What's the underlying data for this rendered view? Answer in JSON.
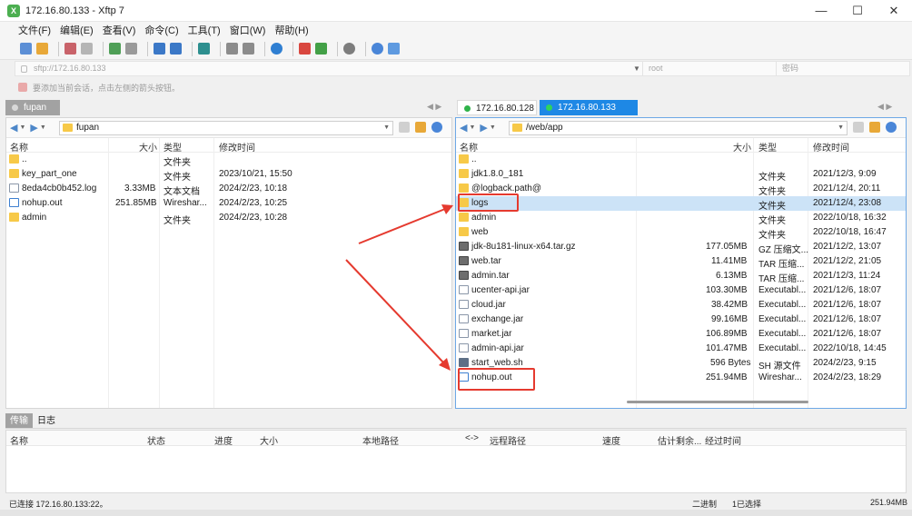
{
  "window": {
    "title": "172.16.80.133 - Xftp 7",
    "app_icon_glyph": "X",
    "minimize": "—",
    "maximize": "☐",
    "close": "✕"
  },
  "menu": [
    "文件(F)",
    "编辑(E)",
    "查看(V)",
    "命令(C)",
    "工具(T)",
    "窗口(W)",
    "帮助(H)"
  ],
  "address": {
    "url_placeholder": "sftp://172.16.80.133",
    "user_placeholder": "root",
    "password_placeholder": "密码"
  },
  "hint": "要添加当前会话，点击左侧的箭头按钮。",
  "tabs": {
    "left": "fupan",
    "right_1": "172.16.80.128",
    "right_2": "172.16.80.133"
  },
  "left_pane": {
    "path": "fupan",
    "columns": {
      "name": "名称",
      "size": "大小",
      "type": "类型",
      "modified": "修改时间"
    },
    "rows": [
      {
        "icon": "folder",
        "name": "..",
        "size": "",
        "type": "文件夹",
        "modified": ""
      },
      {
        "icon": "folder",
        "name": "key_part_one",
        "size": "",
        "type": "文件夹",
        "modified": "2023/10/21, 15:50"
      },
      {
        "icon": "file",
        "name": "8eda4cb0b452.log",
        "size": "3.33MB",
        "type": "文本文档",
        "modified": "2024/2/23, 10:18"
      },
      {
        "icon": "log",
        "name": "nohup.out",
        "size": "251.85MB",
        "type": "Wireshar...",
        "modified": "2024/2/23, 10:25"
      },
      {
        "icon": "folder",
        "name": "admin",
        "size": "",
        "type": "文件夹",
        "modified": "2024/2/23, 10:28"
      }
    ]
  },
  "right_pane": {
    "path": "/web/app",
    "columns": {
      "name": "名称",
      "size": "大小",
      "type": "类型",
      "modified": "修改时间"
    },
    "rows": [
      {
        "icon": "folder",
        "name": "..",
        "size": "",
        "type": "",
        "modified": ""
      },
      {
        "icon": "folder",
        "name": "jdk1.8.0_181",
        "size": "",
        "type": "文件夹",
        "modified": "2021/12/3, 9:09"
      },
      {
        "icon": "folder",
        "name": "@logback.path@",
        "size": "",
        "type": "文件夹",
        "modified": "2021/12/4, 20:11"
      },
      {
        "icon": "folder",
        "name": "logs",
        "size": "",
        "type": "文件夹",
        "modified": "2021/12/4, 23:08"
      },
      {
        "icon": "folder",
        "name": "admin",
        "size": "",
        "type": "文件夹",
        "modified": "2022/10/18, 16:32"
      },
      {
        "icon": "folder",
        "name": "web",
        "size": "",
        "type": "文件夹",
        "modified": "2022/10/18, 16:47"
      },
      {
        "icon": "package",
        "name": "jdk-8u181-linux-x64.tar.gz",
        "size": "177.05MB",
        "type": "GZ 压缩文...",
        "modified": "2021/12/2, 13:07"
      },
      {
        "icon": "package",
        "name": "web.tar",
        "size": "11.41MB",
        "type": "TAR 压缩...",
        "modified": "2021/12/2, 21:05"
      },
      {
        "icon": "package",
        "name": "admin.tar",
        "size": "6.13MB",
        "type": "TAR 压缩...",
        "modified": "2021/12/3, 11:24"
      },
      {
        "icon": "file",
        "name": "ucenter-api.jar",
        "size": "103.30MB",
        "type": "Executabl...",
        "modified": "2021/12/6, 18:07"
      },
      {
        "icon": "file",
        "name": "cloud.jar",
        "size": "38.42MB",
        "type": "Executabl...",
        "modified": "2021/12/6, 18:07"
      },
      {
        "icon": "file",
        "name": "exchange.jar",
        "size": "99.16MB",
        "type": "Executabl...",
        "modified": "2021/12/6, 18:07"
      },
      {
        "icon": "file",
        "name": "market.jar",
        "size": "106.89MB",
        "type": "Executabl...",
        "modified": "2021/12/6, 18:07"
      },
      {
        "icon": "file",
        "name": "admin-api.jar",
        "size": "101.47MB",
        "type": "Executabl...",
        "modified": "2022/10/18, 14:45"
      },
      {
        "icon": "script",
        "name": "start_web.sh",
        "size": "596 Bytes",
        "type": "SH 源文件",
        "modified": "2024/2/23, 9:15"
      },
      {
        "icon": "log",
        "name": "nohup.out",
        "size": "251.94MB",
        "type": "Wireshar...",
        "modified": "2024/2/23, 18:29"
      }
    ]
  },
  "lower_tabs": [
    "传输",
    "日志"
  ],
  "transfer_columns": [
    "名称",
    "状态",
    "进度",
    "大小",
    "本地路径",
    "<->",
    "远程路径",
    "速度",
    "估计剩余...",
    "经过时间"
  ],
  "status": {
    "connection": "已连接 172.16.80.133:22。",
    "mode": "二进制",
    "selected": "1已选择",
    "size": "251.94MB"
  },
  "colors": {
    "accent": "#1e88e5",
    "folder": "#f7c948",
    "annotation": "#e53a2f",
    "selected_row": "#cce3f7"
  }
}
